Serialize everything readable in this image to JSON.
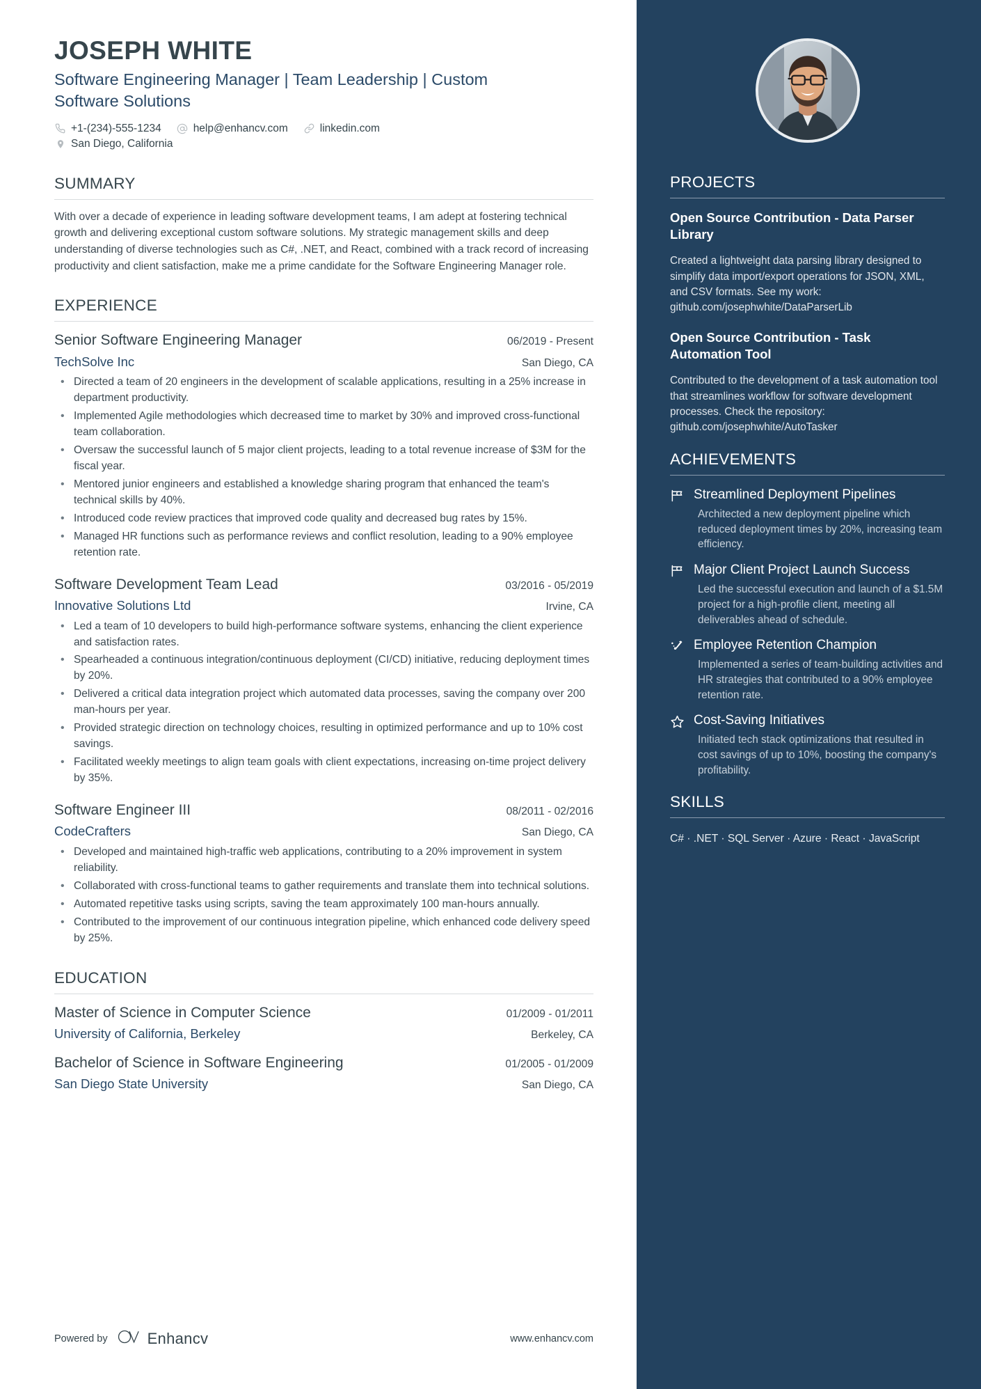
{
  "header": {
    "name": "JOSEPH WHITE",
    "headline": "Software Engineering Manager | Team Leadership | Custom Software Solutions",
    "contacts": [
      {
        "icon": "phone-icon",
        "text": "+1-(234)-555-1234"
      },
      {
        "icon": "email-icon",
        "text": "help@enhancv.com"
      },
      {
        "icon": "link-icon",
        "text": "linkedin.com"
      }
    ],
    "location": {
      "icon": "location-pin-icon",
      "text": "San Diego, California"
    }
  },
  "summary": {
    "title": "SUMMARY",
    "text": "With over a decade of experience in leading software development teams, I am adept at fostering technical growth and delivering exceptional custom software solutions. My strategic management skills and deep understanding of diverse technologies such as C#, .NET, and React, combined with a track record of increasing productivity and client satisfaction, make me a prime candidate for the Software Engineering Manager role."
  },
  "experience": {
    "title": "EXPERIENCE",
    "jobs": [
      {
        "title": "Senior Software Engineering Manager",
        "dates": "06/2019 - Present",
        "company": "TechSolve Inc",
        "location": "San Diego, CA",
        "bullets": [
          "Directed a team of 20 engineers in the development of scalable applications, resulting in a 25% increase in department productivity.",
          "Implemented Agile methodologies which decreased time to market by 30% and improved cross-functional team collaboration.",
          "Oversaw the successful launch of 5 major client projects, leading to a total revenue increase of $3M for the fiscal year.",
          "Mentored junior engineers and established a knowledge sharing program that enhanced the team's technical skills by 40%.",
          "Introduced code review practices that improved code quality and decreased bug rates by 15%.",
          "Managed HR functions such as performance reviews and conflict resolution, leading to a 90% employee retention rate."
        ]
      },
      {
        "title": "Software Development Team Lead",
        "dates": "03/2016 - 05/2019",
        "company": "Innovative Solutions Ltd",
        "location": "Irvine, CA",
        "bullets": [
          "Led a team of 10 developers to build high-performance software systems, enhancing the client experience and satisfaction rates.",
          "Spearheaded a continuous integration/continuous deployment (CI/CD) initiative, reducing deployment times by 20%.",
          "Delivered a critical data integration project which automated data processes, saving the company over 200 man-hours per year.",
          "Provided strategic direction on technology choices, resulting in optimized performance and up to 10% cost savings.",
          "Facilitated weekly meetings to align team goals with client expectations, increasing on-time project delivery by 35%."
        ]
      },
      {
        "title": "Software Engineer III",
        "dates": "08/2011 - 02/2016",
        "company": "CodeCrafters",
        "location": "San Diego, CA",
        "bullets": [
          "Developed and maintained high-traffic web applications, contributing to a 20% improvement in system reliability.",
          "Collaborated with cross-functional teams to gather requirements and translate them into technical solutions.",
          "Automated repetitive tasks using scripts, saving the team approximately 100 man-hours annually.",
          "Contributed to the improvement of our continuous integration pipeline, which enhanced code delivery speed by 25%."
        ]
      }
    ]
  },
  "education": {
    "title": "EDUCATION",
    "items": [
      {
        "degree": "Master of Science in Computer Science",
        "dates": "01/2009 - 01/2011",
        "school": "University of California, Berkeley",
        "location": "Berkeley, CA"
      },
      {
        "degree": "Bachelor of Science in Software Engineering",
        "dates": "01/2005 - 01/2009",
        "school": "San Diego State University",
        "location": "San Diego, CA"
      }
    ]
  },
  "footer": {
    "powered_label": "Powered by",
    "brand": "Enhancv",
    "url": "www.enhancv.com"
  },
  "sidebar": {
    "projects": {
      "title": "PROJECTS",
      "items": [
        {
          "name": "Open Source Contribution - Data Parser Library",
          "description": "Created a lightweight data parsing library designed to simplify data import/export operations for JSON, XML, and CSV formats. See my work: github.com/josephwhite/DataParserLib"
        },
        {
          "name": "Open Source Contribution - Task Automation Tool",
          "description": "Contributed to the development of a task automation tool that streamlines workflow for software development processes. Check the repository: github.com/josephwhite/AutoTasker"
        }
      ]
    },
    "achievements": {
      "title": "ACHIEVEMENTS",
      "items": [
        {
          "icon": "flag-icon",
          "title": "Streamlined Deployment Pipelines",
          "description": "Architected a new deployment pipeline which reduced deployment times by 20%, increasing team efficiency."
        },
        {
          "icon": "flag-icon",
          "title": "Major Client Project Launch Success",
          "description": "Led the successful execution and launch of a $1.5M project for a high-profile client, meeting all deliverables ahead of schedule."
        },
        {
          "icon": "rocket-icon",
          "title": "Employee Retention Champion",
          "description": "Implemented a series of team-building activities and HR strategies that contributed to a 90% employee retention rate."
        },
        {
          "icon": "star-icon",
          "title": "Cost-Saving Initiatives",
          "description": "Initiated tech stack optimizations that resulted in cost savings of up to 10%, boosting the company's profitability."
        }
      ]
    },
    "skills": {
      "title": "SKILLS",
      "text": "C#  ·  .NET · SQL Server · Azure · React · JavaScript"
    }
  },
  "colors": {
    "sidebar_bg": "#23425f",
    "heading": "#36454c",
    "accent_blue": "#2b4a68",
    "body_text": "#3d4a52"
  }
}
